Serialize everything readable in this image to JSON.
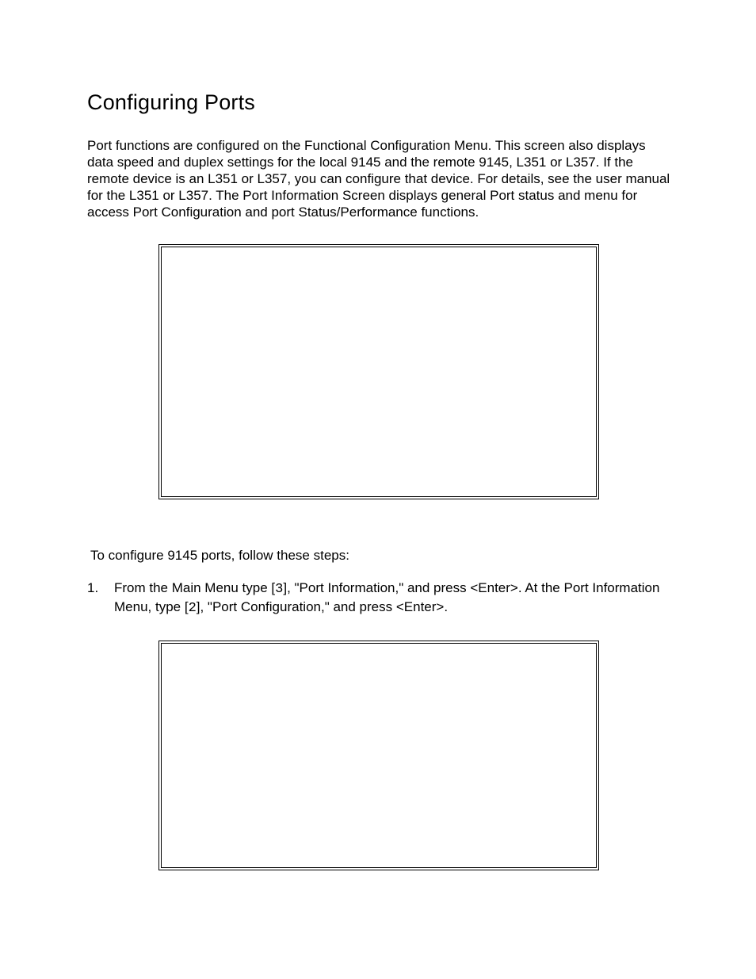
{
  "heading": "Configuring Ports",
  "intro_paragraph": "Port functions are configured on the Functional Configuration Menu. This screen also displays data speed and duplex settings for the local 9145 and the remote 9145, L351 or L357.  If the remote device is an L351 or L357, you can configure that device.  For details, see the user manual for the L351 or L357.   The Port Information Screen displays general Port status and menu for access Port Configuration and port Status/Performance functions.",
  "follow_text": "To configure 9145 ports, follow these steps:",
  "steps": [
    {
      "number": "1.",
      "prefix": "From the Main Menu type [",
      "code1": "3",
      "mid1": "], \"Port Information,\" and press <Enter>.  At the Port Information Menu, type [",
      "code2": "2",
      "suffix": "], \"Port Configuration,\" and press <Enter>."
    }
  ]
}
